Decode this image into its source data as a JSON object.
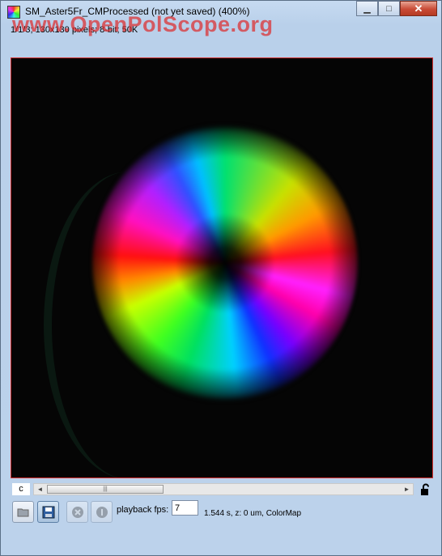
{
  "window": {
    "title": "SM_Aster5Fr_CMProcessed (not yet saved) (400%)",
    "info_line": "1/1/3; 130x130 pixels; 8-bit; 50K",
    "watermark": "www.OpenPolScope.org"
  },
  "caption_buttons": {
    "minimize": "▁",
    "maximize": "□",
    "close": "✕"
  },
  "image": {
    "description_icon": "colormap-aster-image"
  },
  "slider": {
    "channel_label": "c",
    "left_arrow": "◄",
    "right_arrow": "►",
    "thumb_grip": "|||"
  },
  "toolbar": {
    "fps_label": "playback fps:",
    "fps_value": "7",
    "status_text": "1.544 s, z: 0 um, ColorMap"
  },
  "colors": {
    "frame_border": "#d43030",
    "watermark": "#de2828"
  }
}
